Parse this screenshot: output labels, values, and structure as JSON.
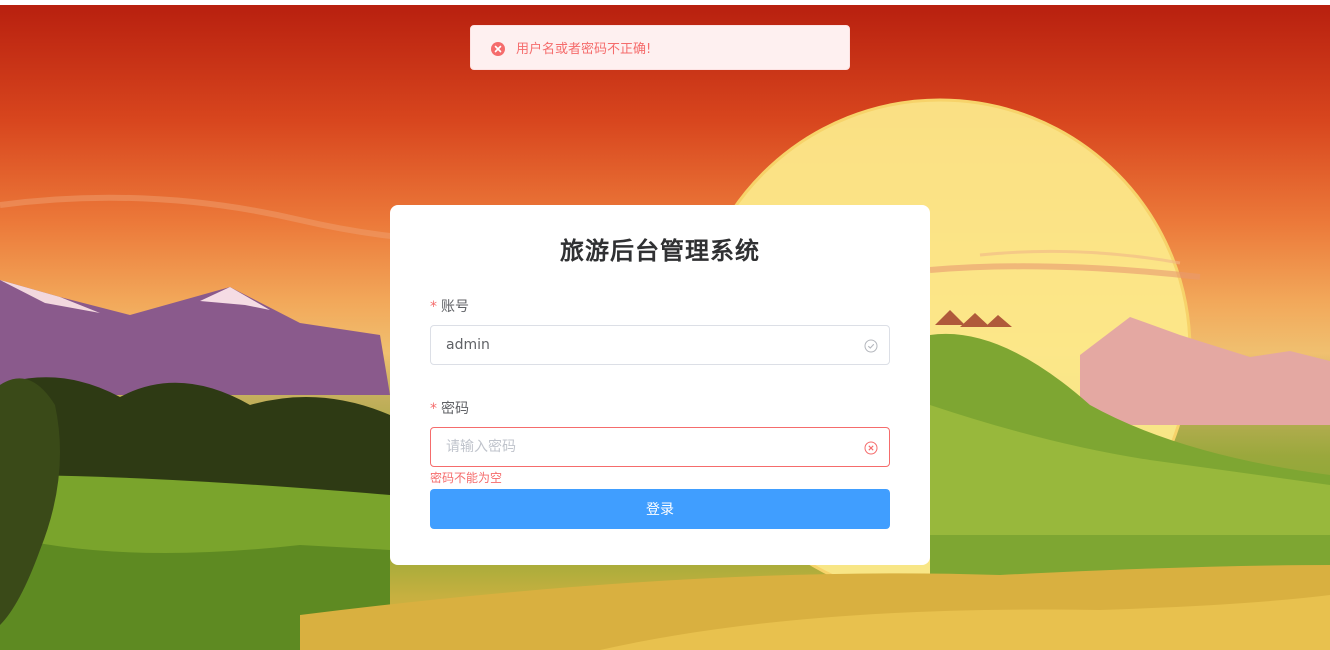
{
  "toast": {
    "type": "error",
    "icon": "error-circle-icon",
    "message": "用户名或者密码不正确!",
    "color": "#f56c6c"
  },
  "login": {
    "title": "旅游后台管理系统",
    "account": {
      "required_mark": "*",
      "label": "账号",
      "value": "admin",
      "status_icon": "check-circle-icon"
    },
    "password": {
      "required_mark": "*",
      "label": "密码",
      "value": "",
      "placeholder": "请输入密码",
      "status_icon": "error-circle-icon",
      "error": "密码不能为空"
    },
    "submit_label": "登录",
    "accent_color": "#409eff"
  }
}
